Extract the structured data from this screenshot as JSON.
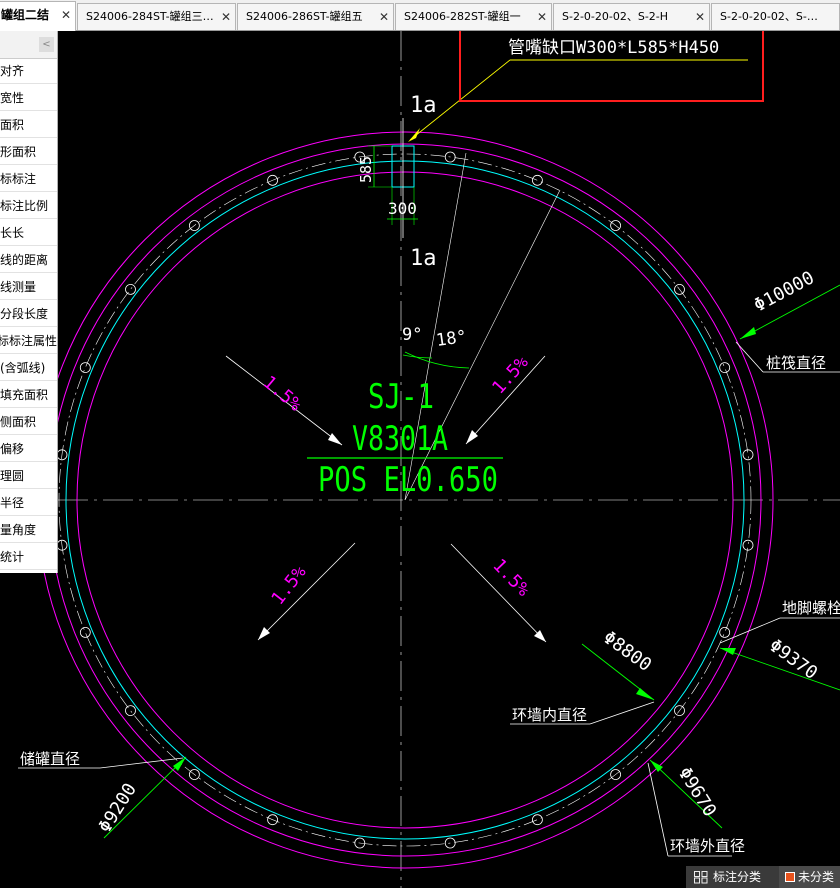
{
  "tabs": [
    {
      "label": "罐组二结",
      "active": true
    },
    {
      "label": "S24006-284ST-罐组三…",
      "active": false
    },
    {
      "label": "S24006-286ST-罐组五",
      "active": false
    },
    {
      "label": "S24006-282ST-罐组一",
      "active": false
    },
    {
      "label": "S-2-0-20-02、S-2-H",
      "active": false
    },
    {
      "label": "S-2-0-20-02、S-2-H-",
      "active": false
    }
  ],
  "tab_close_glyph": "✕",
  "panel": {
    "collapse_glyph": "<",
    "items": [
      "对齐",
      "宽性",
      "面积",
      "形面积",
      "标标注",
      "标注比例",
      "长长",
      "线的距离",
      "线测量",
      "分段长度",
      "标标注属性",
      "(含弧线)",
      "填充面积",
      "侧面积",
      "偏移",
      "理圆",
      "半径",
      "量角度",
      "统计"
    ]
  },
  "drawing": {
    "callout": "管嘴缺口W300*L585*H450",
    "section_top": "1a",
    "section_bottom": "1a",
    "dim_585": "585",
    "dim_300": "300",
    "angle_9": "9°",
    "angle_18": "18°",
    "slope_ul": "1.5%",
    "slope_ur": "1.5%",
    "slope_ll": "1.5%",
    "slope_lr": "1.5%",
    "title_id": "SJ-1",
    "title_tag": "V8301A",
    "title_pos": "POS EL0.650",
    "dia_10000": "Φ10000",
    "label_pile": "桩筏直径",
    "label_bolt": "地脚螺栓直",
    "dia_9370": "Φ9370",
    "dia_8800": "Φ8800",
    "label_inner": "环墙内直径",
    "label_tank": "储罐直径",
    "dia_9200": "Φ9200",
    "dia_9670": "Φ9670",
    "label_outer": "环墙外直径",
    "colors": {
      "magenta": "#ff00ff",
      "cyan": "#00ffff",
      "white": "#ffffff",
      "green": "#00ff00",
      "yellow": "#ffff00",
      "red": "#ff1e1e"
    }
  },
  "status": {
    "icon": "category-icon",
    "label": "标注分类",
    "category": "未分类"
  }
}
